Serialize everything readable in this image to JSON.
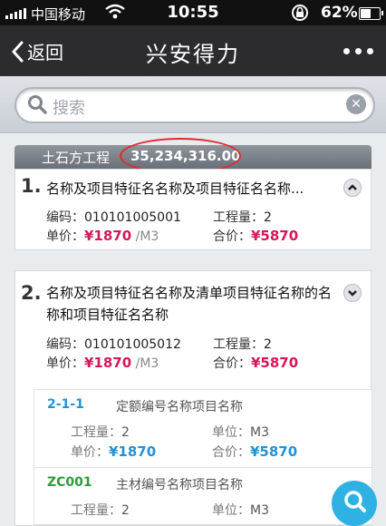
{
  "status_bar": {
    "carrier": "中国移动",
    "time": "10:55",
    "battery": "62%",
    "battery_level": 0.62
  },
  "nav": {
    "back_label": "返回",
    "title": "兴安得力",
    "more_icon": "more-dots-icon"
  },
  "search": {
    "placeholder": "搜索",
    "icon": "search-icon",
    "clear_icon": "clear-icon"
  },
  "section": {
    "name": "土石方工程",
    "total": "35,234,316.00"
  },
  "labels": {
    "code": "编码：",
    "quantity": "工程量：",
    "unit_price": "单价：",
    "total_price": "合价：",
    "unit": "单位："
  },
  "items": [
    {
      "index": "1.",
      "name": "名称及项目特征名名称及项目特征名名称...",
      "code": "010101005001",
      "quantity": "2",
      "unit_price": "¥1870",
      "unit_suffix": "/M3",
      "total_price": "¥5870"
    },
    {
      "index": "2.",
      "name": "名称及项目特征名名称及清单项目特征名称的名称和项目特征名名称",
      "code": "010101005012",
      "quantity": "2",
      "unit_price": "¥1870",
      "unit_suffix": "/M3",
      "total_price": "¥5870",
      "subitems": [
        {
          "code": "2-1-1",
          "code_color": "#1f93d6",
          "name": "定额编号名称项目名称",
          "quantity": "2",
          "unit": "M3",
          "unit_price": "¥1870",
          "total_price": "¥5870"
        },
        {
          "code": "ZC001",
          "code_color": "#2e9a3a",
          "name": "主材编号名称项目名称",
          "quantity": "2",
          "unit": "M3"
        }
      ]
    }
  ],
  "colors": {
    "price_red": "#d6175a",
    "price_blue": "#1f93d6",
    "highlight_ring": "#e0282e"
  }
}
